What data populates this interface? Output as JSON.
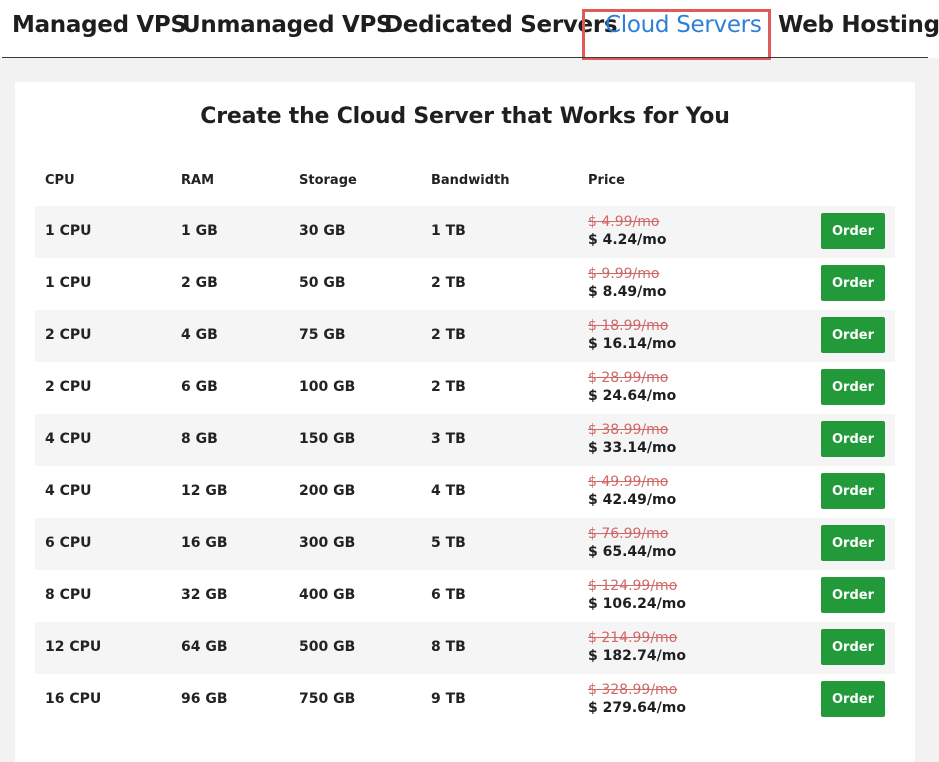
{
  "tabs": [
    {
      "label": "Managed VPS",
      "active": false
    },
    {
      "label": "Unmanaged VPS",
      "active": false
    },
    {
      "label": "Dedicated Servers",
      "active": false
    },
    {
      "label": "Cloud Servers",
      "active": true
    },
    {
      "label": "Web Hosting",
      "active": false
    }
  ],
  "card": {
    "title": "Create the Cloud Server that Works for You",
    "headers": {
      "cpu": "CPU",
      "ram": "RAM",
      "storage": "Storage",
      "bandwidth": "Bandwidth",
      "price": "Price"
    },
    "rows": [
      {
        "cpu": "1 CPU",
        "ram": "1 GB",
        "storage": "30 GB",
        "bandwidth": "1 TB",
        "old_price": "$ 4.99/mo",
        "price": "$ 4.24/mo",
        "action": "Order"
      },
      {
        "cpu": "1 CPU",
        "ram": "2 GB",
        "storage": "50 GB",
        "bandwidth": "2 TB",
        "old_price": "$ 9.99/mo",
        "price": "$ 8.49/mo",
        "action": "Order"
      },
      {
        "cpu": "2 CPU",
        "ram": "4 GB",
        "storage": "75 GB",
        "bandwidth": "2 TB",
        "old_price": "$ 18.99/mo",
        "price": "$ 16.14/mo",
        "action": "Order"
      },
      {
        "cpu": "2 CPU",
        "ram": "6 GB",
        "storage": "100 GB",
        "bandwidth": "2 TB",
        "old_price": "$ 28.99/mo",
        "price": "$ 24.64/mo",
        "action": "Order"
      },
      {
        "cpu": "4 CPU",
        "ram": "8 GB",
        "storage": "150 GB",
        "bandwidth": "3 TB",
        "old_price": "$ 38.99/mo",
        "price": "$ 33.14/mo",
        "action": "Order"
      },
      {
        "cpu": "4 CPU",
        "ram": "12 GB",
        "storage": "200 GB",
        "bandwidth": "4 TB",
        "old_price": "$ 49.99/mo",
        "price": "$ 42.49/mo",
        "action": "Order"
      },
      {
        "cpu": "6 CPU",
        "ram": "16 GB",
        "storage": "300 GB",
        "bandwidth": "5 TB",
        "old_price": "$ 76.99/mo",
        "price": "$ 65.44/mo",
        "action": "Order"
      },
      {
        "cpu": "8 CPU",
        "ram": "32 GB",
        "storage": "400 GB",
        "bandwidth": "6 TB",
        "old_price": "$ 124.99/mo",
        "price": "$ 106.24/mo",
        "action": "Order"
      },
      {
        "cpu": "12 CPU",
        "ram": "64 GB",
        "storage": "500 GB",
        "bandwidth": "8 TB",
        "old_price": "$ 214.99/mo",
        "price": "$ 182.74/mo",
        "action": "Order"
      },
      {
        "cpu": "16 CPU",
        "ram": "96 GB",
        "storage": "750 GB",
        "bandwidth": "9 TB",
        "old_price": "$ 328.99/mo",
        "price": "$ 279.64/mo",
        "action": "Order"
      }
    ]
  },
  "colors": {
    "active_tab": "#2f7fd8",
    "highlight_box": "#e05a5a",
    "order_button": "#229a3a",
    "old_price": "#d06868"
  }
}
